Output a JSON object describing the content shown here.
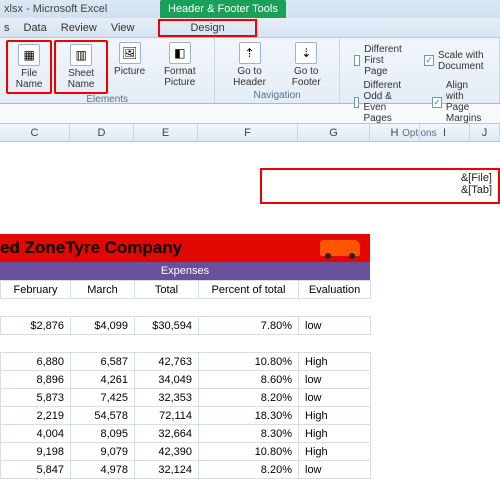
{
  "title": "xlsx - Microsoft Excel",
  "hf_tools": "Header & Footer Tools",
  "menu": {
    "m1": "s",
    "m2": "Data",
    "m3": "Review",
    "m4": "View",
    "design": "Design"
  },
  "ribbon": {
    "file_name": "File\nName",
    "sheet_name": "Sheet\nName",
    "picture": "Picture",
    "format_picture": "Format\nPicture",
    "goto_header": "Go to\nHeader",
    "goto_footer": "Go to\nFooter",
    "g1": "Elements",
    "g2": "Navigation",
    "opt1": "Different First Page",
    "opt2": "Scale with Document",
    "opt3": "Different Odd & Even Pages",
    "opt4": "Align with Page Margins",
    "g3": "Options"
  },
  "cols": {
    "c": "C",
    "d": "D",
    "e": "E",
    "f": "F",
    "g": "G",
    "h": "H",
    "i": "I",
    "j": "J"
  },
  "header_codes": {
    "l1": "&[File]",
    "l2": "&[Tab]"
  },
  "company": "ed ZoneTyre Company",
  "expenses": "Expenses",
  "th": {
    "feb": "February",
    "mar": "March",
    "total": "Total",
    "pct": "Percent of total",
    "eval": "Evaluation"
  },
  "rows": [
    {
      "feb": "$2,876",
      "mar": "$4,099",
      "total": "$30,594",
      "pct": "7.80%",
      "eval": "low"
    },
    {
      "feb": "6,880",
      "mar": "6,587",
      "total": "42,763",
      "pct": "10.80%",
      "eval": "High"
    },
    {
      "feb": "8,896",
      "mar": "4,261",
      "total": "34,049",
      "pct": "8.60%",
      "eval": "low"
    },
    {
      "feb": "5,873",
      "mar": "7,425",
      "total": "32,353",
      "pct": "8.20%",
      "eval": "low"
    },
    {
      "feb": "2,219",
      "mar": "54,578",
      "total": "72,114",
      "pct": "18.30%",
      "eval": "High"
    },
    {
      "feb": "4,004",
      "mar": "8,095",
      "total": "32,664",
      "pct": "8.30%",
      "eval": "High"
    },
    {
      "feb": "9,198",
      "mar": "9,079",
      "total": "42,390",
      "pct": "10.80%",
      "eval": "High"
    },
    {
      "feb": "5,847",
      "mar": "4,978",
      "total": "32,124",
      "pct": "8.20%",
      "eval": "low"
    }
  ]
}
